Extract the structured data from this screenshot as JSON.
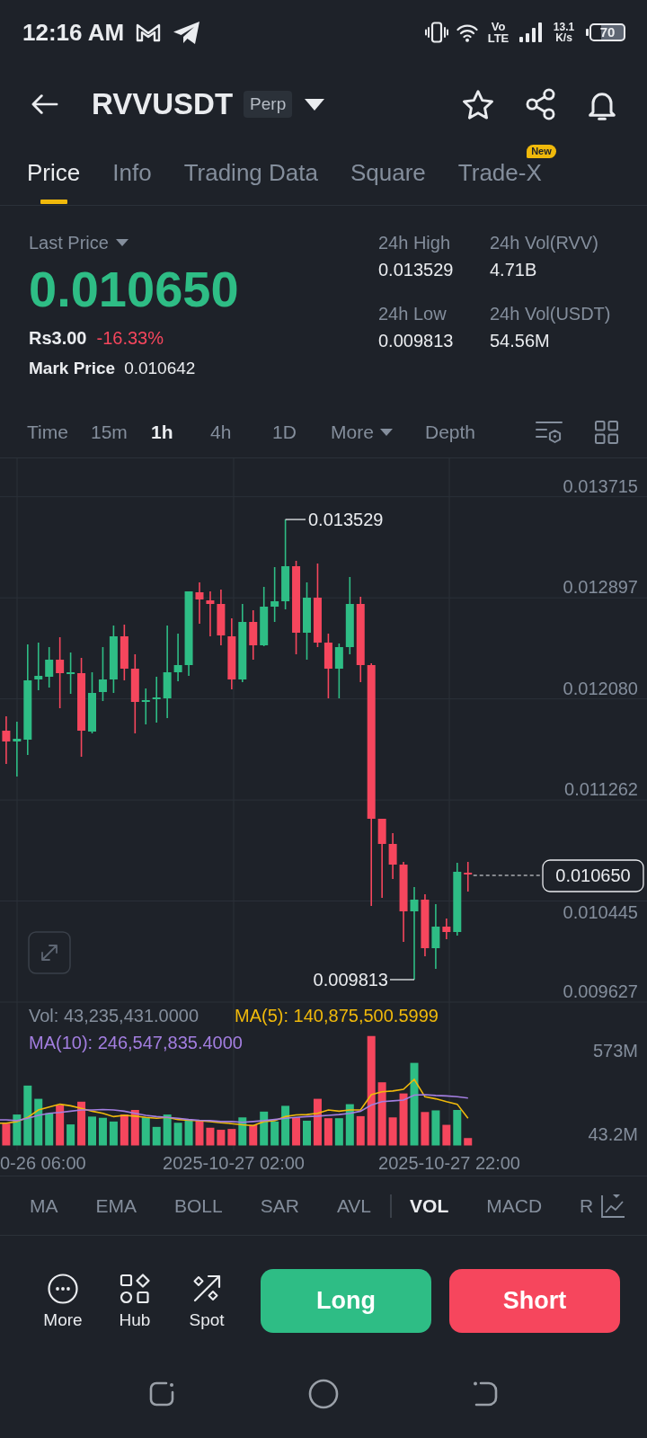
{
  "status_bar": {
    "time": "12:16 AM",
    "network_type": "Vo LTE",
    "data_speed": "13.1 K/s",
    "battery": "70"
  },
  "header": {
    "symbol": "RVVUSDT",
    "contract_badge": "Perp"
  },
  "tabs": [
    {
      "label": "Price",
      "selected": true
    },
    {
      "label": "Info",
      "selected": false
    },
    {
      "label": "Trading Data",
      "selected": false
    },
    {
      "label": "Square",
      "selected": false
    },
    {
      "label": "Trade-X",
      "selected": false,
      "badge": "New"
    }
  ],
  "ticker": {
    "last_price_label": "Last Price",
    "last_price": "0.010650",
    "fiat_price": "Rs3.00",
    "change_percent": "-16.33%",
    "mark_price_label": "Mark Price",
    "mark_price": "0.010642",
    "stats": [
      {
        "label": "24h High",
        "value": "0.013529"
      },
      {
        "label": "24h Vol(RVV)",
        "value": "4.71B"
      },
      {
        "label": "24h Low",
        "value": "0.009813"
      },
      {
        "label": "24h Vol(USDT)",
        "value": "54.56M"
      }
    ]
  },
  "intervals": [
    {
      "label": "Time",
      "selected": false,
      "kind": "option"
    },
    {
      "label": "15m",
      "selected": false,
      "kind": "option"
    },
    {
      "label": "1h",
      "selected": true,
      "kind": "option"
    },
    {
      "label": "4h",
      "selected": false,
      "kind": "option"
    },
    {
      "label": "1D",
      "selected": false,
      "kind": "option"
    },
    {
      "label": "More",
      "selected": false,
      "kind": "dropdown"
    },
    {
      "label": "Depth",
      "selected": false,
      "kind": "option"
    }
  ],
  "chart": {
    "price_axis": [
      "0.013715",
      "0.012897",
      "0.012080",
      "0.011262",
      "0.010445",
      "0.009627"
    ],
    "high_marker": "0.013529",
    "low_marker": "0.009813",
    "current_price_tag": "0.010650",
    "volume_legend": [
      {
        "text": "Vol: 43,235,431.0000",
        "color": "#848e9c"
      },
      {
        "text": "MA(5): 140,875,500.5999",
        "color": "#f0b90b"
      },
      {
        "text": "MA(10): 246,547,835.4000",
        "color": "#a37ee0"
      }
    ],
    "volume_axis": [
      "573M",
      "43.2M"
    ],
    "time_axis": [
      "0-26 06:00",
      "2025-10-27 02:00",
      "2025-10-27 22:00"
    ]
  },
  "indicators": [
    {
      "label": "MA",
      "selected": false,
      "divider_before": false
    },
    {
      "label": "EMA",
      "selected": false,
      "divider_before": false
    },
    {
      "label": "BOLL",
      "selected": false,
      "divider_before": false
    },
    {
      "label": "SAR",
      "selected": false,
      "divider_before": false
    },
    {
      "label": "AVL",
      "selected": false,
      "divider_before": false
    },
    {
      "label": "VOL",
      "selected": true,
      "divider_before": true
    },
    {
      "label": "MACD",
      "selected": false,
      "divider_before": false
    },
    {
      "label": "R",
      "selected": false,
      "divider_before": false
    }
  ],
  "shortcuts": [
    {
      "label": "More",
      "kind": "more"
    },
    {
      "label": "Hub",
      "kind": "hub"
    },
    {
      "label": "Spot",
      "kind": "spot"
    }
  ],
  "trade_buttons": [
    {
      "label": "Long",
      "kind": "long"
    },
    {
      "label": "Short",
      "kind": "short"
    }
  ]
}
